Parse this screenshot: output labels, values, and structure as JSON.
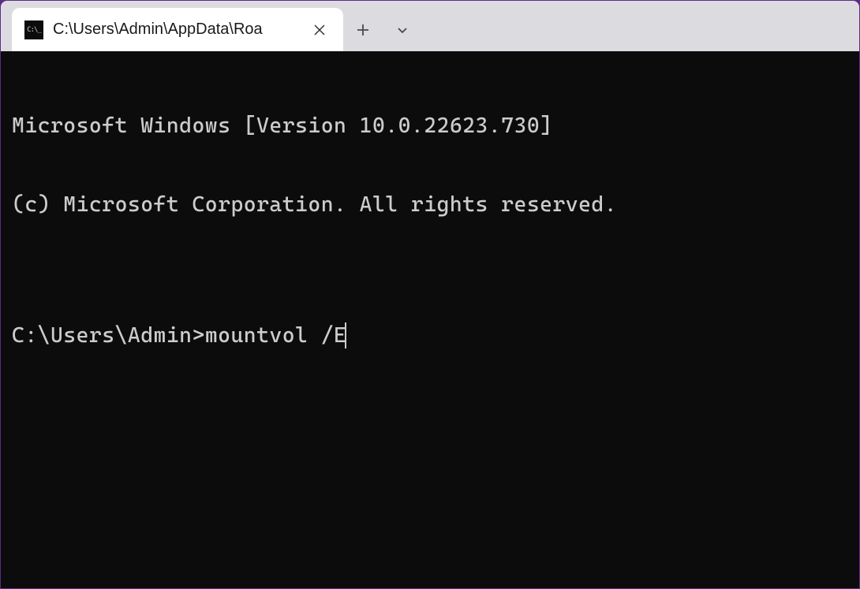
{
  "tab": {
    "title": "C:\\Users\\Admin\\AppData\\Roa",
    "icon_text": "C:\\_"
  },
  "terminal": {
    "line1": "Microsoft Windows [Version 10.0.22623.730]",
    "line2": "(c) Microsoft Corporation. All rights reserved.",
    "blank": "",
    "prompt": "C:\\Users\\Admin>",
    "command": "mountvol /E"
  }
}
